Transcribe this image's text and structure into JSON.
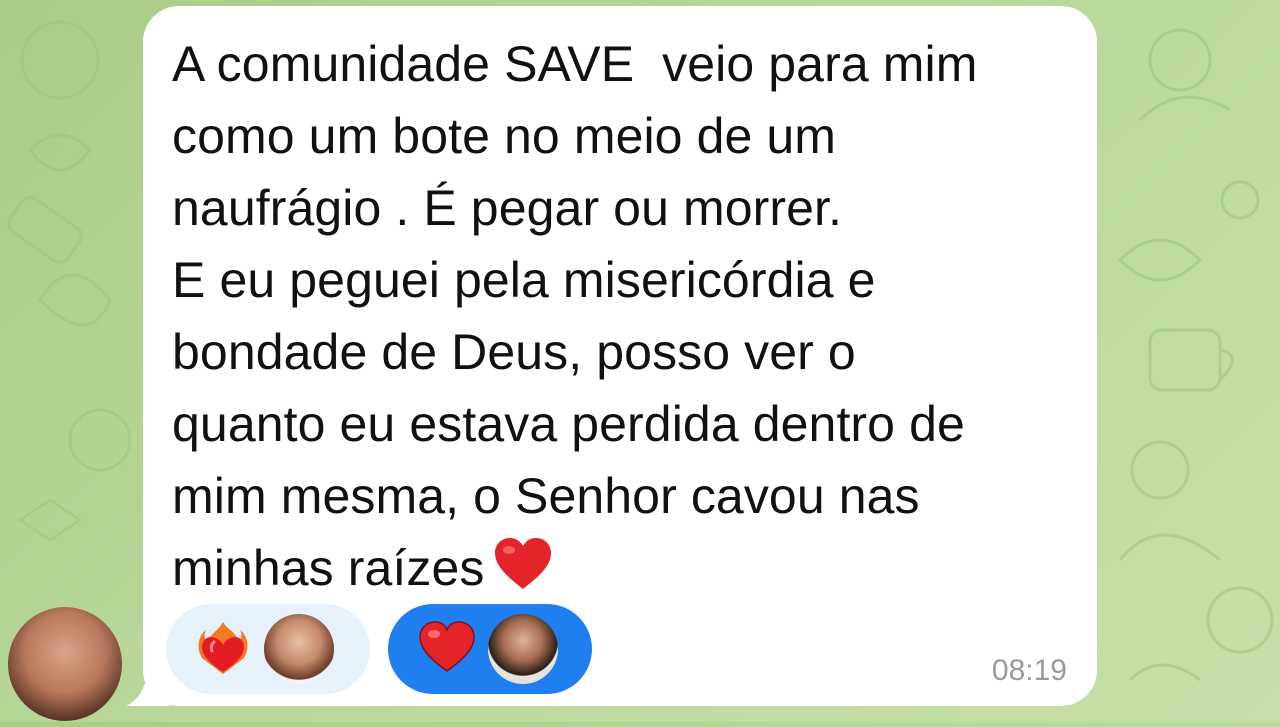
{
  "chat": {
    "message": {
      "text": "A comunidade SAVE  veio para mim\ncomo um bote no meio de um\nnaufrágio . É pegar ou morrer.\nE eu peguei pela misericórdia e\nbondade de Deus, posso ver o\nquanto eu estava perdida dentro de\nmim mesma, o Senhor cavou nas\nminhas raízes",
      "trailing_emoji": "heart",
      "time": "08:19"
    },
    "reactions": [
      {
        "emoji": "fire-heart",
        "style": "light"
      },
      {
        "emoji": "red-heart",
        "style": "blue-selected"
      }
    ]
  },
  "colors": {
    "background": "#b9d89a",
    "bubble": "#ffffff",
    "text": "#111111",
    "reaction_selected": "#1f7ef0",
    "reaction_default": "#e7f1fb",
    "timestamp": "#9a9a9a",
    "heart": "#e3242b"
  }
}
